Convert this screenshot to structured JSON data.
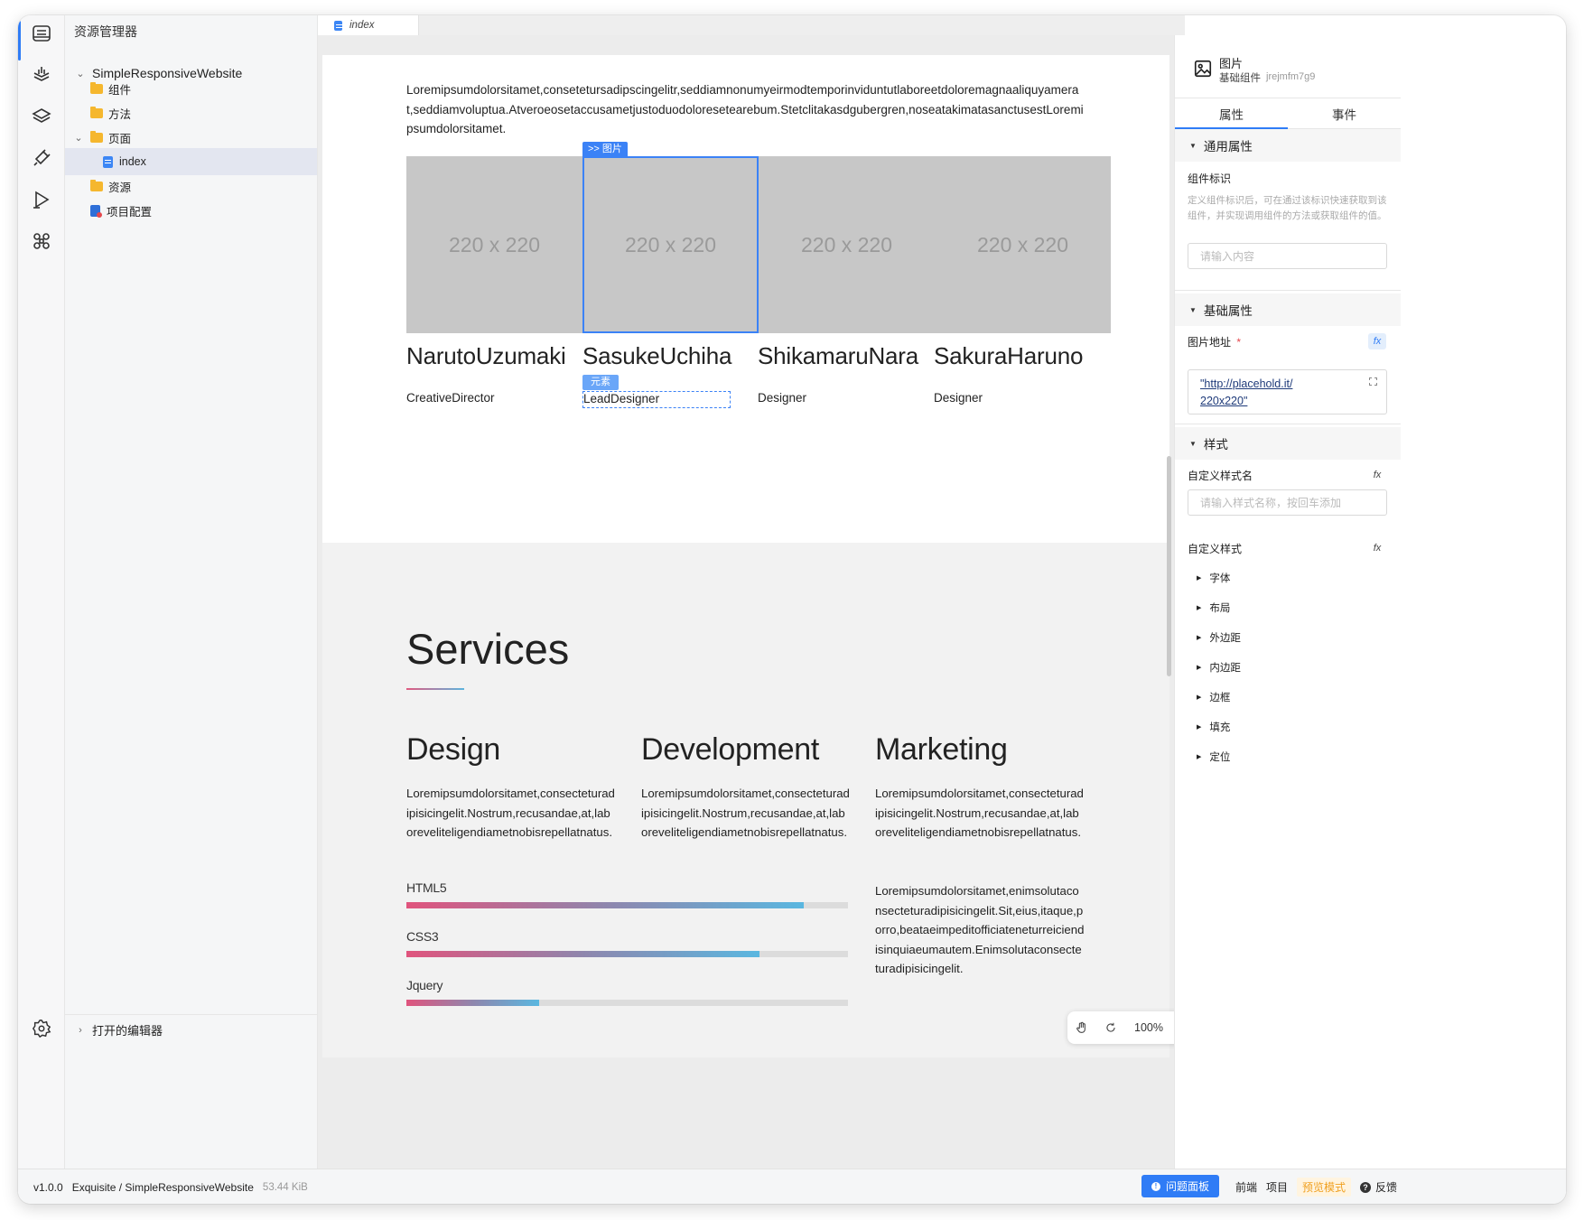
{
  "explorer": {
    "title": "资源管理器",
    "project": "SimpleResponsiveWebsite",
    "items": [
      {
        "label": "组件",
        "type": "folder"
      },
      {
        "label": "方法",
        "type": "folder"
      },
      {
        "label": "页面",
        "type": "folder"
      },
      {
        "label": "index",
        "type": "file"
      },
      {
        "label": "资源",
        "type": "folder"
      },
      {
        "label": "项目配置",
        "type": "config"
      }
    ],
    "open_editors": "打开的编辑器"
  },
  "activity_icons": [
    "explorer-icon",
    "components-icon",
    "layers-icon",
    "plugin-icon",
    "run-icon",
    "command-icon",
    "settings-icon"
  ],
  "editor": {
    "tab_label": "index"
  },
  "page": {
    "intro": "Loremipsumdolorsitamet,consetetursadipscingelitr,seddiamnonumyeirmodtemporinviduntutlaboreetdoloremagnaaliquyamerat,seddiamvoluptua.Atveroeosetaccusametjustoduodoloresetearebum.Stetclitakasdgubergren,noseatakimatasanctusestLoremipsumdolorsitamet.",
    "selection_tag": ">> 图片",
    "element_tag": "元素",
    "team": [
      {
        "placeholder": "220 x 220",
        "name": "NarutoUzumaki",
        "role": "CreativeDirector"
      },
      {
        "placeholder": "220 x 220",
        "name": "SasukeUchiha",
        "role": "LeadDesigner"
      },
      {
        "placeholder": "220 x 220",
        "name": "ShikamaruNara",
        "role": "Designer"
      },
      {
        "placeholder": "220 x 220",
        "name": "SakuraHaruno",
        "role": "Designer"
      }
    ],
    "services": {
      "title": "Services",
      "columns": [
        {
          "heading": "Design",
          "text": "Loremipsumdolorsitamet,consecteturadipisicingelit.Nostrum,recusandae,at,laboreveliteligendiametnobisrepellatnatus."
        },
        {
          "heading": "Development",
          "text": "Loremipsumdolorsitamet,consecteturadipisicingelit.Nostrum,recusandae,at,laboreveliteligendiametnobisrepellatnatus."
        },
        {
          "heading": "Marketing",
          "text": "Loremipsumdolorsitamet,consecteturadipisicingelit.Nostrum,recusandae,at,laboreveliteligendiametnobisrepellatnatus.",
          "text2": "Loremipsumdolorsitamet,enimsolutaconsecteturadipisicingelit.Sit,eius,itaque,porro,beataeimpeditofficiateneturreiciendisinquiaeumautem.Enimsolutaconsecteturadipisicingelit."
        }
      ],
      "skills": [
        {
          "label": "HTML5",
          "level": 0.9
        },
        {
          "label": "CSS3",
          "level": 0.8
        },
        {
          "label": "Jquery",
          "level": 0.3
        }
      ]
    }
  },
  "zoom": {
    "value": "100%"
  },
  "props": {
    "component_name": "图片",
    "component_type": "基础组件",
    "component_id": "jrejmfm7g9",
    "tabs": [
      "属性",
      "事件"
    ],
    "sections": {
      "general": "通用属性",
      "basic": "基础属性",
      "style": "样式"
    },
    "id_label": "组件标识",
    "id_hint": "定义组件标识后，可在通过该标识快速获取到该组件，并实现调用组件的方法或获取组件的值。",
    "id_placeholder": "请输入内容",
    "src_label": "图片地址",
    "src_required": "*",
    "src_value_1": "\"http://placehold.it/",
    "src_value_2": "220x220\"",
    "class_label": "自定义样式名",
    "class_placeholder": "请输入样式名称，按回车添加",
    "custom_style_label": "自定义样式",
    "fx": "fx",
    "style_groups": [
      "字体",
      "布局",
      "外边距",
      "内边距",
      "边框",
      "填充",
      "定位"
    ]
  },
  "statusbar": {
    "version": "v1.0.0",
    "path": "Exquisite / SimpleResponsiveWebsite",
    "size": "53.44 KiB",
    "issues": "问题面板",
    "frontend": "前端",
    "project": "项目",
    "preview": "预览模式",
    "feedback": "反馈"
  },
  "colors": {
    "accent": "#2f7cf6",
    "folder": "#f5b72e",
    "gradient_start": "#e0547d",
    "gradient_end": "#5ab7e0"
  }
}
